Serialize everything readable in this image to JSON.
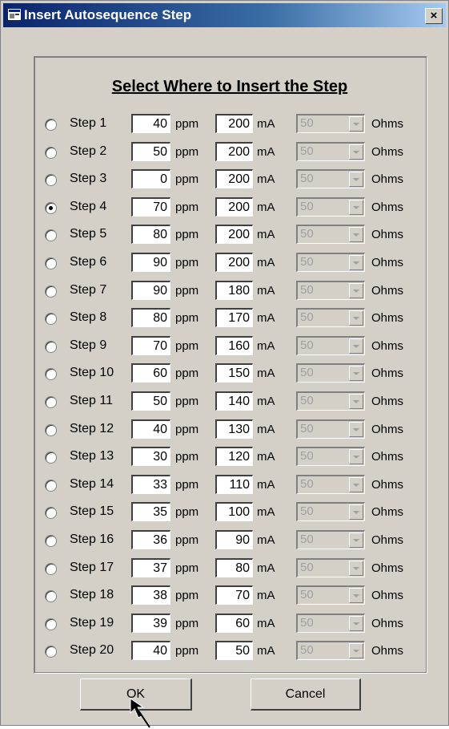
{
  "window": {
    "title": "Insert Autosequence Step",
    "close_label": "×"
  },
  "heading": "Select Where to Insert the Step",
  "units": {
    "ppm": "ppm",
    "ma": "mA",
    "ohms": "Ohms"
  },
  "steps": [
    {
      "label": "Step 1",
      "ppm": "40",
      "ma": "200",
      "ohm": "50",
      "selected": false
    },
    {
      "label": "Step 2",
      "ppm": "50",
      "ma": "200",
      "ohm": "50",
      "selected": false
    },
    {
      "label": "Step 3",
      "ppm": "0",
      "ma": "200",
      "ohm": "50",
      "selected": false
    },
    {
      "label": "Step 4",
      "ppm": "70",
      "ma": "200",
      "ohm": "50",
      "selected": true
    },
    {
      "label": "Step 5",
      "ppm": "80",
      "ma": "200",
      "ohm": "50",
      "selected": false
    },
    {
      "label": "Step 6",
      "ppm": "90",
      "ma": "200",
      "ohm": "50",
      "selected": false
    },
    {
      "label": "Step 7",
      "ppm": "90",
      "ma": "180",
      "ohm": "50",
      "selected": false
    },
    {
      "label": "Step 8",
      "ppm": "80",
      "ma": "170",
      "ohm": "50",
      "selected": false
    },
    {
      "label": "Step 9",
      "ppm": "70",
      "ma": "160",
      "ohm": "50",
      "selected": false
    },
    {
      "label": "Step 10",
      "ppm": "60",
      "ma": "150",
      "ohm": "50",
      "selected": false
    },
    {
      "label": "Step 11",
      "ppm": "50",
      "ma": "140",
      "ohm": "50",
      "selected": false
    },
    {
      "label": "Step 12",
      "ppm": "40",
      "ma": "130",
      "ohm": "50",
      "selected": false
    },
    {
      "label": "Step 13",
      "ppm": "30",
      "ma": "120",
      "ohm": "50",
      "selected": false
    },
    {
      "label": "Step 14",
      "ppm": "33",
      "ma": "110",
      "ohm": "50",
      "selected": false
    },
    {
      "label": "Step 15",
      "ppm": "35",
      "ma": "100",
      "ohm": "50",
      "selected": false
    },
    {
      "label": "Step 16",
      "ppm": "36",
      "ma": "90",
      "ohm": "50",
      "selected": false
    },
    {
      "label": "Step 17",
      "ppm": "37",
      "ma": "80",
      "ohm": "50",
      "selected": false
    },
    {
      "label": "Step 18",
      "ppm": "38",
      "ma": "70",
      "ohm": "50",
      "selected": false
    },
    {
      "label": "Step 19",
      "ppm": "39",
      "ma": "60",
      "ohm": "50",
      "selected": false
    },
    {
      "label": "Step 20",
      "ppm": "40",
      "ma": "50",
      "ohm": "50",
      "selected": false
    }
  ],
  "buttons": {
    "ok": "OK",
    "cancel": "Cancel"
  },
  "icons": {
    "title": "window-app-icon",
    "cursor": "mouse-pointer-icon"
  }
}
